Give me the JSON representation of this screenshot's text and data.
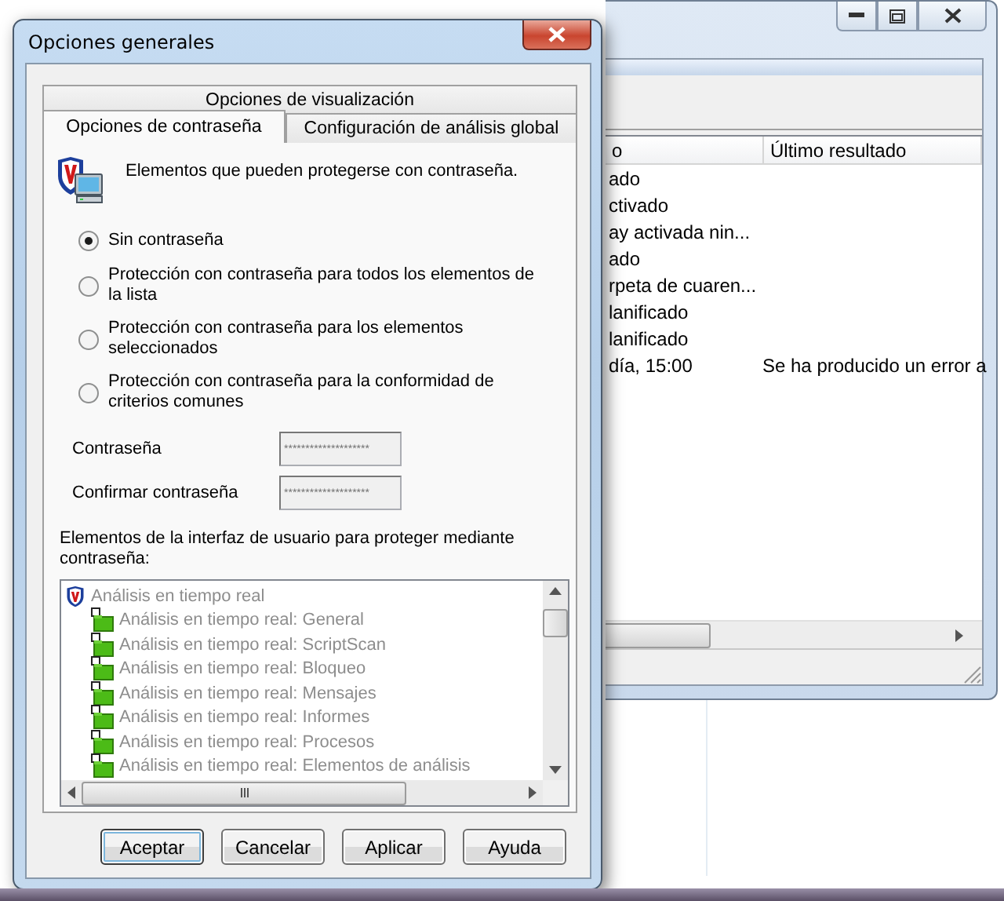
{
  "main_window": {
    "columns": [
      "o",
      "Último resultado"
    ],
    "rows": [
      {
        "cells": [
          "ado"
        ]
      },
      {
        "cells": [
          "ctivado"
        ]
      },
      {
        "cells": [
          "ay activada nin..."
        ]
      },
      {
        "cells": [
          "ado"
        ]
      },
      {
        "cells": [
          "rpeta de cuaren..."
        ]
      },
      {
        "cells": [
          "lanificado"
        ]
      },
      {
        "cells": [
          "lanificado"
        ]
      },
      {
        "cells": [
          "día, 15:00",
          "Se ha producido un error a"
        ]
      }
    ]
  },
  "dialog": {
    "title": "Opciones generales",
    "tab_rows": [
      {
        "tabs": [
          {
            "label": "Opciones de visualización",
            "selected": false
          }
        ]
      },
      {
        "tabs": [
          {
            "label": "Opciones de contraseña",
            "selected": true
          },
          {
            "label": "Configuración de análisis global",
            "selected": false
          }
        ]
      }
    ],
    "intro": "Elementos que pueden protegerse con contraseña.",
    "password_modes": [
      {
        "label": "Sin contraseña",
        "selected": true
      },
      {
        "label": "Protección con contraseña para todos los elementos de la lista",
        "selected": false
      },
      {
        "label": "Protección con contraseña para los elementos seleccionados",
        "selected": false
      },
      {
        "label": "Protección con contraseña para la conformidad de criterios comunes",
        "selected": false
      }
    ],
    "fields": [
      {
        "label": "Contraseña",
        "value": "********************",
        "disabled": true
      },
      {
        "label": "Confirmar contraseña",
        "value": "********************",
        "disabled": true
      }
    ],
    "tree_label": "Elementos de la interfaz de usuario para proteger mediante contraseña:",
    "tree": {
      "label": "Análisis en tiempo real",
      "disabled": true,
      "children": [
        {
          "label": "Análisis en tiempo real: General"
        },
        {
          "label": "Análisis en tiempo real: ScriptScan"
        },
        {
          "label": "Análisis en tiempo real: Bloqueo"
        },
        {
          "label": "Análisis en tiempo real: Mensajes"
        },
        {
          "label": "Análisis en tiempo real: Informes"
        },
        {
          "label": "Análisis en tiempo real: Procesos"
        },
        {
          "label": "Análisis en tiempo real: Elementos de análisis"
        }
      ]
    },
    "buttons": [
      {
        "label": "Aceptar",
        "default": true
      },
      {
        "label": "Cancelar",
        "default": false
      },
      {
        "label": "Aplicar",
        "default": false
      },
      {
        "label": "Ayuda",
        "default": false
      }
    ]
  }
}
